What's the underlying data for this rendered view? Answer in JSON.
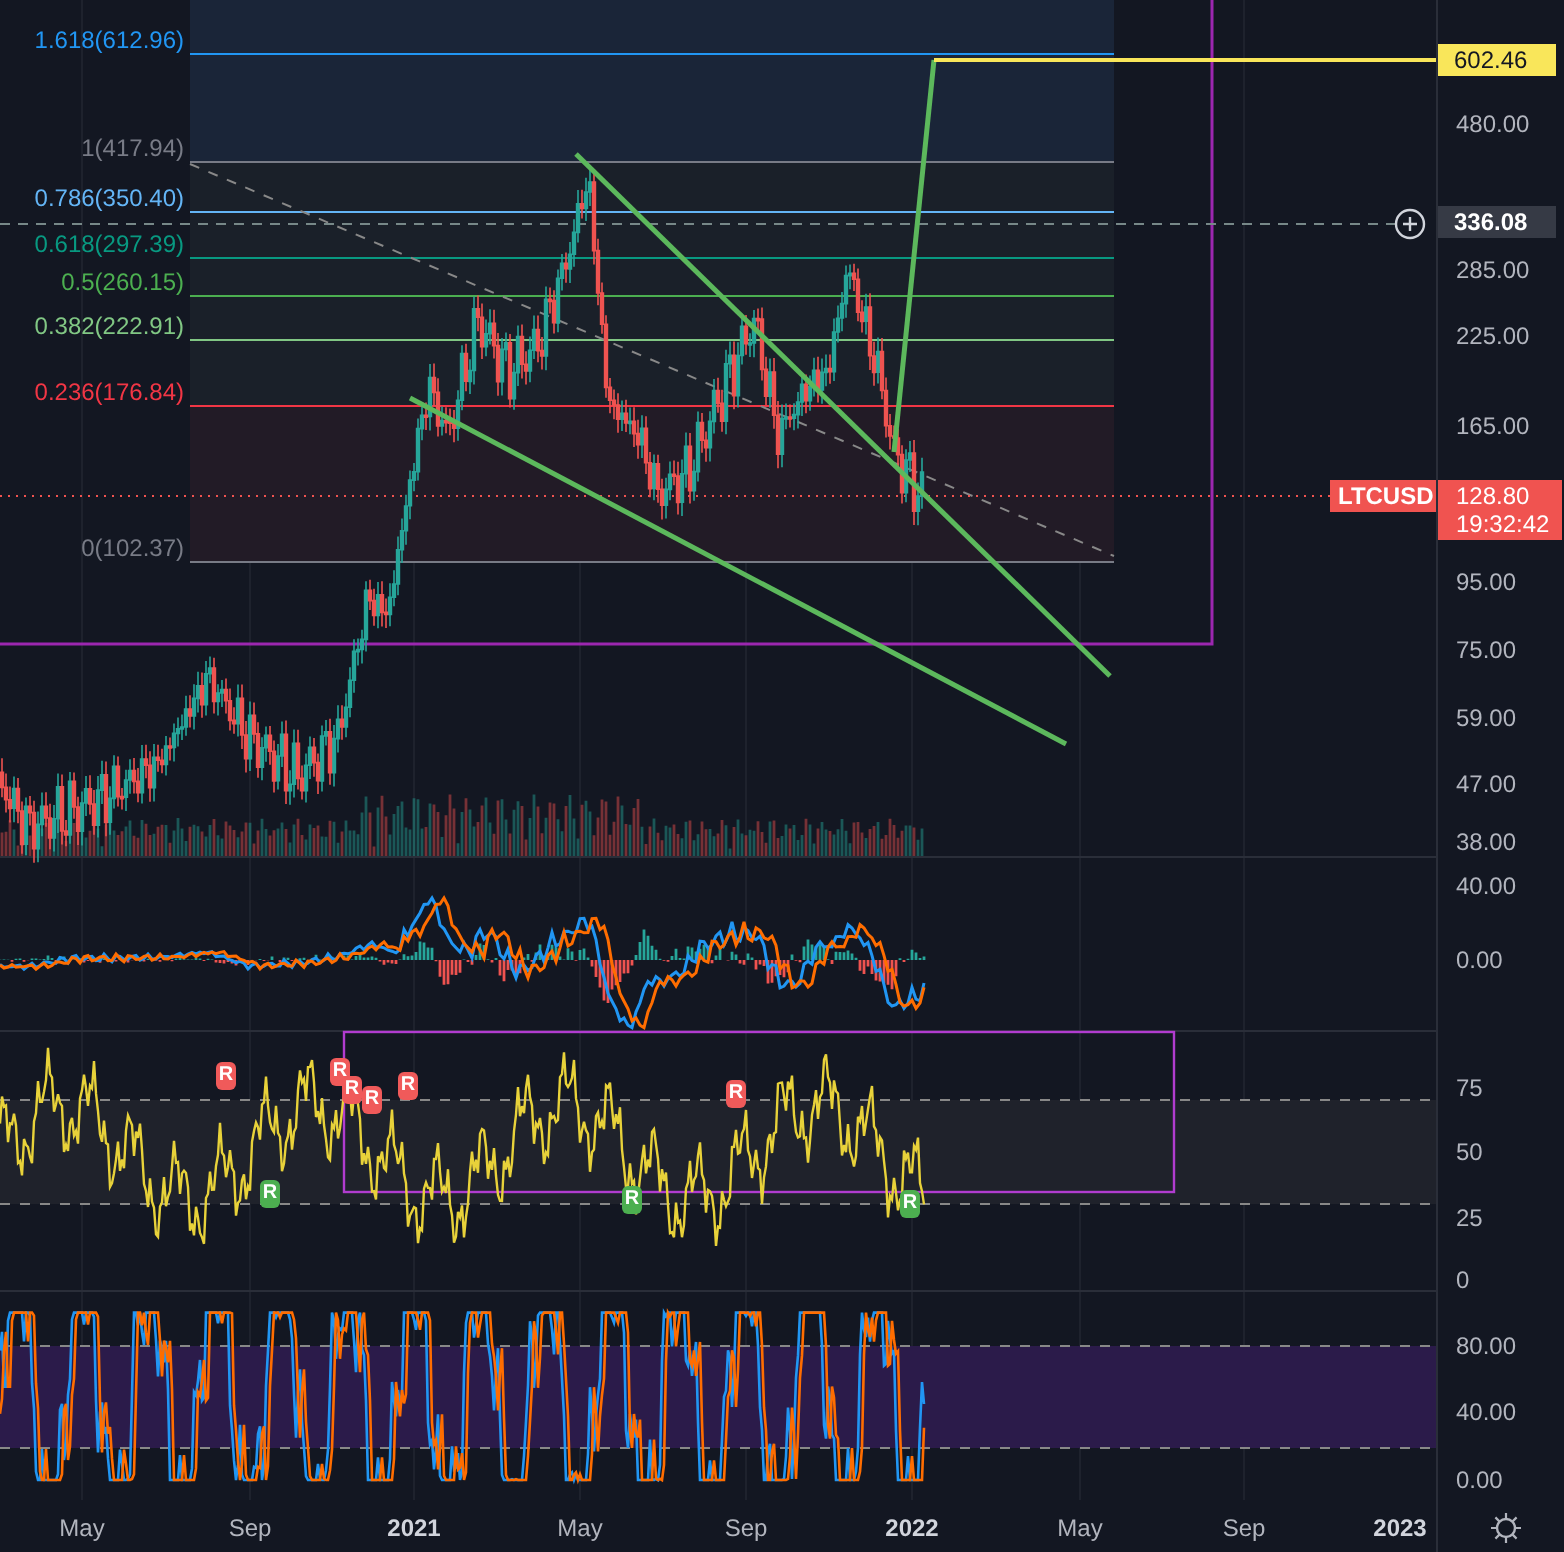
{
  "symbol_label": "LTCUSD",
  "fib_levels": [
    {
      "label": "1.618(612.96)",
      "color": "#2196f3"
    },
    {
      "label": "1(417.94)",
      "color": "#787b86"
    },
    {
      "label": "0.786(350.40)",
      "color": "#64b5f6"
    },
    {
      "label": "0.618(297.39)",
      "color": "#089981"
    },
    {
      "label": "0.5(260.15)",
      "color": "#4caf50"
    },
    {
      "label": "0.382(222.91)",
      "color": "#81c784"
    },
    {
      "label": "0.236(176.84)",
      "color": "#f23645"
    },
    {
      "label": "0(102.37)",
      "color": "#787b86"
    }
  ],
  "price_axis": {
    "ticks": [
      "480.00",
      "285.00",
      "225.00",
      "165.00",
      "95.00",
      "75.00",
      "59.00",
      "47.00",
      "38.00"
    ]
  },
  "price_labels": {
    "target": "602.46",
    "crosshair": "336.08",
    "last_price": "128.80",
    "countdown": "19:32:42"
  },
  "macd_axis": {
    "ticks": [
      "40.00",
      "0.00"
    ]
  },
  "rsi_axis": {
    "ticks": [
      "75",
      "50",
      "25",
      "0"
    ]
  },
  "rsi_signals": [
    {
      "label": "R",
      "kind": "bearish"
    },
    {
      "label": "R",
      "kind": "bearish"
    },
    {
      "label": "R",
      "kind": "bearish"
    },
    {
      "label": "R",
      "kind": "bearish"
    },
    {
      "label": "R",
      "kind": "bearish"
    },
    {
      "label": "R",
      "kind": "bearish"
    },
    {
      "label": "R",
      "kind": "bullish"
    },
    {
      "label": "R",
      "kind": "bullish"
    },
    {
      "label": "R",
      "kind": "bullish"
    }
  ],
  "stoch_axis": {
    "ticks": [
      "80.00",
      "40.00",
      "0.00"
    ]
  },
  "time_axis": {
    "labels": [
      {
        "text": "May",
        "kind": "month"
      },
      {
        "text": "Sep",
        "kind": "month"
      },
      {
        "text": "2021",
        "kind": "year"
      },
      {
        "text": "May",
        "kind": "month"
      },
      {
        "text": "Sep",
        "kind": "month"
      },
      {
        "text": "2022",
        "kind": "year"
      },
      {
        "text": "May",
        "kind": "month"
      },
      {
        "text": "Sep",
        "kind": "month"
      },
      {
        "text": "2023",
        "kind": "year"
      }
    ]
  }
}
